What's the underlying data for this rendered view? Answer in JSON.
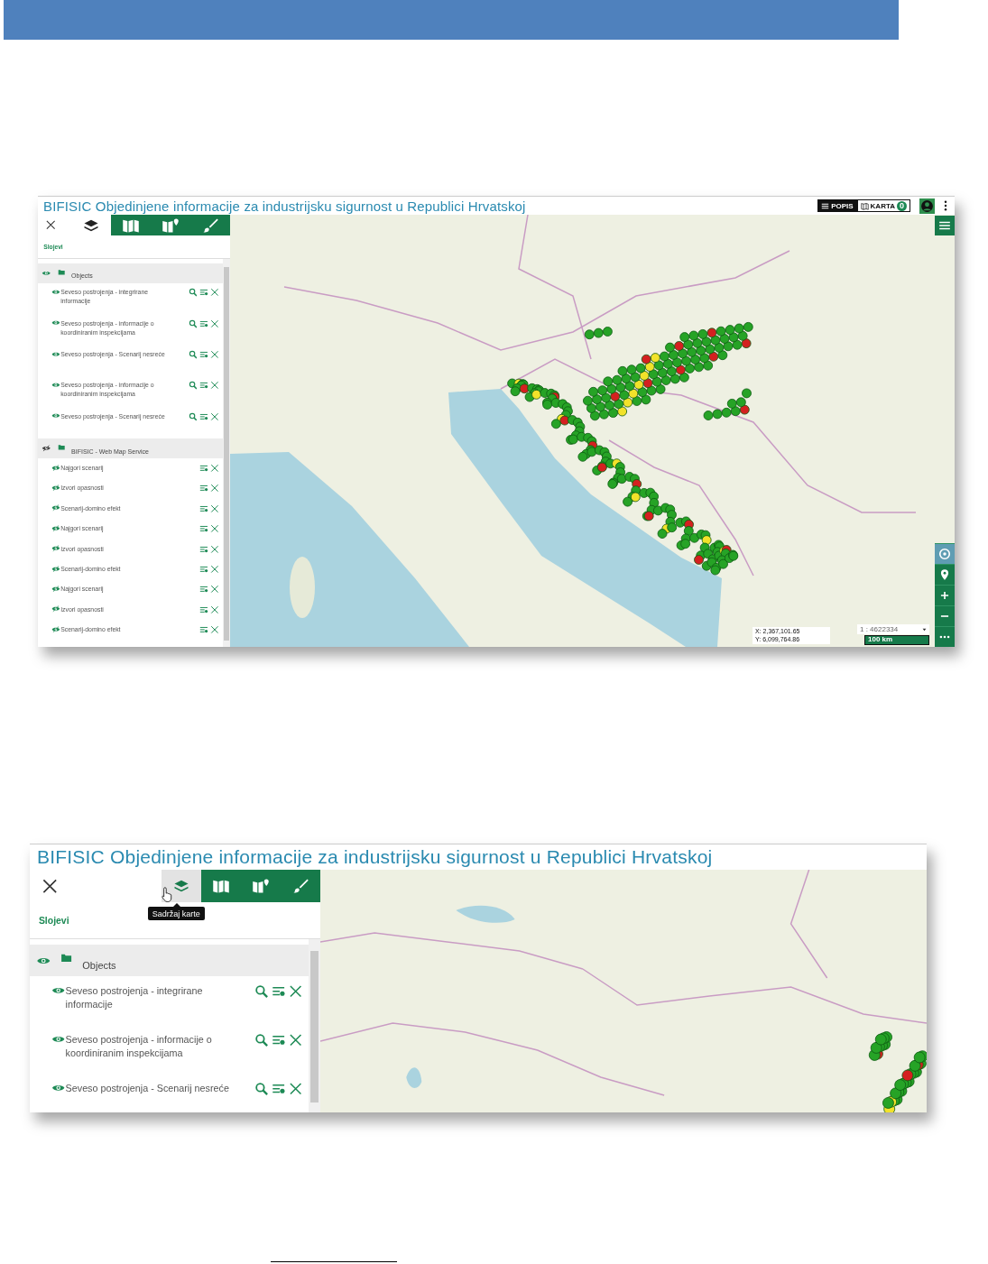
{
  "screenshots": [
    {
      "title": "BIFISIC Objedinjene informacije za industrijsku sigurnost u Republici Hrvatskoj",
      "header_buttons": [
        {
          "kind": "list",
          "label": "POPIS"
        },
        {
          "kind": "map",
          "label": "KARTA",
          "badge": "0"
        }
      ],
      "panel": {
        "section": "Slojevi",
        "tabs": [
          {
            "kind": "layers",
            "selected": true,
            "hovered": false
          },
          {
            "kind": "maps",
            "selected": false,
            "hovered": false
          },
          {
            "kind": "map-pin",
            "selected": false,
            "hovered": false
          },
          {
            "kind": "draw",
            "selected": false,
            "hovered": false
          }
        ],
        "groups": [
          {
            "name": "Objects",
            "visible": true,
            "layers": [
              {
                "name": "Seveso postrojenja - integrirane informacije",
                "visible": true,
                "kind": "vector"
              },
              {
                "name": "Seveso postrojenja - informacije o koordiniranim inspekcijama",
                "visible": true,
                "kind": "vector"
              },
              {
                "name": "Seveso postrojenja - Scenarij nesreće",
                "visible": true,
                "kind": "vector"
              },
              {
                "name": "Seveso postrojenja - informacije o koordiniranim inspekcijama",
                "visible": true,
                "kind": "vector"
              },
              {
                "name": "Seveso postrojenja - Scenarij nesreće",
                "visible": true,
                "kind": "vector"
              }
            ]
          },
          {
            "name": "BIFISIC - Web Map Service",
            "visible": false,
            "layers": [
              {
                "name": "Najgori scenarij",
                "visible": false,
                "kind": "wms"
              },
              {
                "name": "Izvori opasnosti",
                "visible": false,
                "kind": "wms"
              },
              {
                "name": "Scenarij-domino efekt",
                "visible": false,
                "kind": "wms"
              },
              {
                "name": "Najgori scenarij",
                "visible": false,
                "kind": "wms"
              },
              {
                "name": "Izvori opasnosti",
                "visible": false,
                "kind": "wms"
              },
              {
                "name": "Scenarij-domino efekt",
                "visible": false,
                "kind": "wms"
              },
              {
                "name": "Najgori scenarij",
                "visible": false,
                "kind": "wms"
              },
              {
                "name": "Izvori opasnosti",
                "visible": false,
                "kind": "wms"
              },
              {
                "name": "Scenarij-domino efekt",
                "visible": false,
                "kind": "wms"
              }
            ]
          }
        ]
      },
      "map": {
        "kind": "croatia",
        "controls": [
          {
            "kind": "menu"
          },
          {
            "kind": "settings"
          },
          {
            "kind": "location"
          },
          {
            "kind": "zoom-in"
          },
          {
            "kind": "zoom-out"
          },
          {
            "kind": "more"
          }
        ],
        "coordinates": [
          "X: 2,367,101.65",
          "Y: 6,099,764.86"
        ],
        "scale": "1 : 4622334",
        "scale_bar": "100 km"
      }
    },
    {
      "title": "BIFISIC Objedinjene informacije za industrijsku sigurnost u Republici Hrvatskoj",
      "tooltip": "Sadržaj karte",
      "panel": {
        "section": "Slojevi",
        "tabs": [
          {
            "kind": "layers",
            "selected": true,
            "hovered": true
          },
          {
            "kind": "maps",
            "selected": false,
            "hovered": false
          },
          {
            "kind": "map-pin",
            "selected": false,
            "hovered": false
          },
          {
            "kind": "draw",
            "selected": false,
            "hovered": false
          }
        ],
        "groups": [
          {
            "name": "Objects",
            "visible": true,
            "layers": [
              {
                "name": "Seveso postrojenja - integrirane informacije",
                "visible": true,
                "kind": "vector"
              },
              {
                "name": "Seveso postrojenja - informacije o koordiniranim inspekcijama",
                "visible": true,
                "kind": "vector"
              },
              {
                "name": "Seveso postrojenja - Scenarij nesreće",
                "visible": true,
                "kind": "vector"
              }
            ]
          }
        ]
      },
      "map": {
        "kind": "alps"
      }
    }
  ]
}
